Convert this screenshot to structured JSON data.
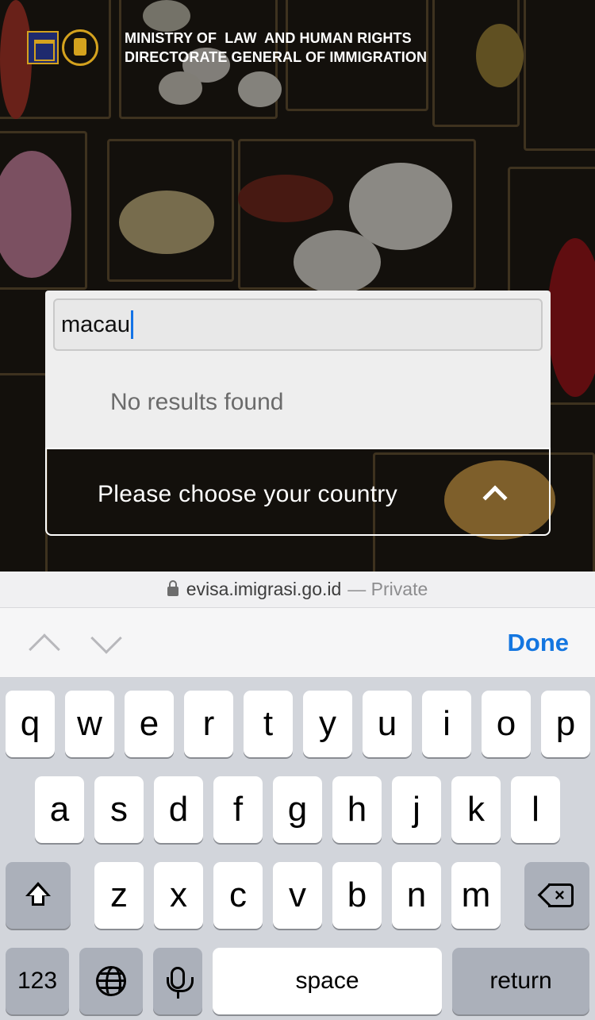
{
  "header": {
    "line1": "MINISTRY OF  LAW  AND HUMAN RIGHTS",
    "line2": "DIRECTORATE GENERAL OF IMMIGRATION"
  },
  "country_select": {
    "search_value": "macau",
    "no_results": "No results found",
    "placeholder": "Please choose your country"
  },
  "browser": {
    "url": "evisa.imigrasi.go.id",
    "mode": "— Private"
  },
  "accessory": {
    "done_label": "Done"
  },
  "keyboard": {
    "row1": [
      "q",
      "w",
      "e",
      "r",
      "t",
      "y",
      "u",
      "i",
      "o",
      "p"
    ],
    "row2": [
      "a",
      "s",
      "d",
      "f",
      "g",
      "h",
      "j",
      "k",
      "l"
    ],
    "row3": [
      "z",
      "x",
      "c",
      "v",
      "b",
      "n",
      "m"
    ],
    "numbers_label": "123",
    "space_label": "space",
    "return_label": "return"
  },
  "colors": {
    "accent": "#1476e0",
    "caret": "#1473e6"
  }
}
